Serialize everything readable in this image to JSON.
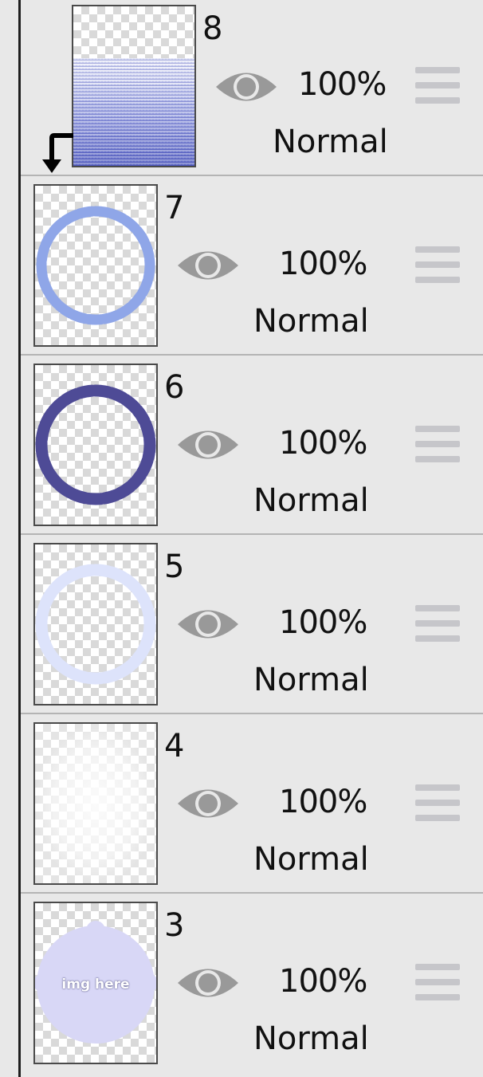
{
  "layers": [
    {
      "number": "8",
      "opacity": "100%",
      "mode": "Normal",
      "visible": true,
      "clipping": true,
      "thumbnail": "blue-gradient-halftone"
    },
    {
      "number": "7",
      "opacity": "100%",
      "mode": "Normal",
      "visible": true,
      "clipping": false,
      "thumbnail": "light-blue-scalloped-ring"
    },
    {
      "number": "6",
      "opacity": "100%",
      "mode": "Normal",
      "visible": true,
      "clipping": false,
      "thumbnail": "dark-indigo-scalloped-ring"
    },
    {
      "number": "5",
      "opacity": "100%",
      "mode": "Normal",
      "visible": true,
      "clipping": false,
      "thumbnail": "pale-blue-scalloped-ring"
    },
    {
      "number": "4",
      "opacity": "100%",
      "mode": "Normal",
      "visible": true,
      "clipping": false,
      "thumbnail": "faint-white-blur"
    },
    {
      "number": "3",
      "opacity": "100%",
      "mode": "Normal",
      "visible": true,
      "clipping": false,
      "thumbnail": "lavender-blob",
      "thumbnail_text": "img here"
    }
  ],
  "colors": {
    "ring_light_blue": "#8fa6e8",
    "ring_dark_indigo": "#4e4b96",
    "ring_pale_blue": "#dde3fb",
    "blob_lavender": "#d8d7f6",
    "gradient_top": "#ffffff",
    "gradient_bottom": "#3c47b4",
    "eye_gray": "#999999",
    "handle_gray": "#c6c6ca"
  },
  "icons": {
    "visibility": "eye-icon",
    "reorder": "drag-handle-icon",
    "clipping": "clipping-arrow-icon"
  }
}
